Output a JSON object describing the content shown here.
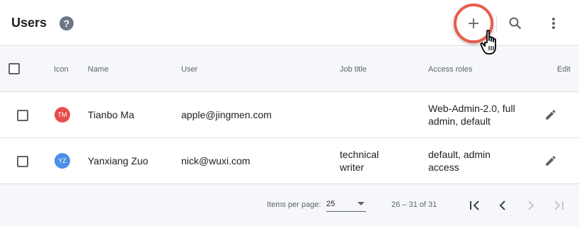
{
  "header": {
    "title": "Users",
    "help_icon": "help-circle-icon",
    "help_glyph": "?",
    "actions": {
      "add_icon": "plus-icon",
      "search_icon": "search-icon",
      "more_icon": "more-vert-icon"
    },
    "highlight_color": "#ea5b4a",
    "cursor_icon": "hand-pointer-icon"
  },
  "table": {
    "columns": {
      "select": "",
      "icon": "Icon",
      "name": "Name",
      "user": "User",
      "job_title": "Job title",
      "access_roles": "Access roles",
      "edit": "Edit"
    },
    "rows": [
      {
        "initials": "TM",
        "avatar_color": "#ea4c4c",
        "name": "Tianbo Ma",
        "user": "apple@jingmen.com",
        "job_title_lines": [
          "",
          ""
        ],
        "access_roles_lines": [
          "Web-Admin-2.0, full",
          "admin, default"
        ],
        "edit_icon": "pencil-icon"
      },
      {
        "initials": "YZ",
        "avatar_color": "#4a8fe8",
        "name": "Yanxiang Zuo",
        "user": "nick@wuxi.com",
        "job_title_lines": [
          "technical",
          "writer"
        ],
        "access_roles_lines": [
          "default, admin",
          "access"
        ],
        "edit_icon": "pencil-icon"
      }
    ]
  },
  "footer": {
    "items_per_page_label": "Items per page:",
    "items_per_page_value": "25",
    "range_label": "26 – 31 of 31",
    "first_icon": "first-page-icon",
    "prev_icon": "chevron-left-icon",
    "next_icon": "chevron-right-icon",
    "last_icon": "last-page-icon"
  }
}
